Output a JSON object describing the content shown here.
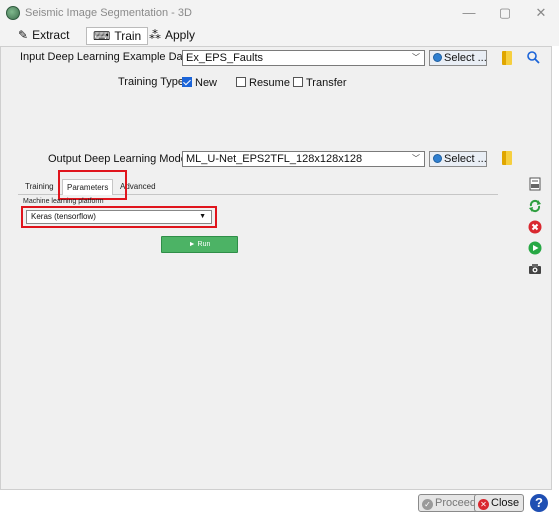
{
  "window": {
    "title": "Seismic Image Segmentation - 3D",
    "minimize": "—",
    "maximize": "▢",
    "close": "✕"
  },
  "toolbar": {
    "extract": "Extract",
    "train": "Train",
    "apply": "Apply",
    "extract_icon": "✎",
    "train_icon": "⌨",
    "apply_icon": "⁂"
  },
  "input": {
    "label": "Input Deep Learning Example Data",
    "value": "Ex_EPS_Faults",
    "select": "Select ..."
  },
  "training_type": {
    "label": "Training Type",
    "options": [
      {
        "label": "New",
        "checked": true
      },
      {
        "label": "Resume",
        "checked": false
      },
      {
        "label": "Transfer",
        "checked": false
      }
    ]
  },
  "output": {
    "label": "Output Deep Learning Model",
    "value": "ML_U-Net_EPS2TFL_128x128x128",
    "select": "Select ..."
  },
  "tabs": [
    {
      "label": "Training"
    },
    {
      "label": "Parameters"
    },
    {
      "label": "Advanced"
    }
  ],
  "parameters": {
    "platform_label": "Machine learning platform",
    "platform_value": "Keras (tensorflow)",
    "run": "► Run"
  },
  "footer": {
    "proceed": "Proceed",
    "close": "Close",
    "help": "?"
  },
  "colors": {
    "highlight": "#e0141c",
    "run": "#4cb365",
    "accent": "#1b64d8"
  }
}
